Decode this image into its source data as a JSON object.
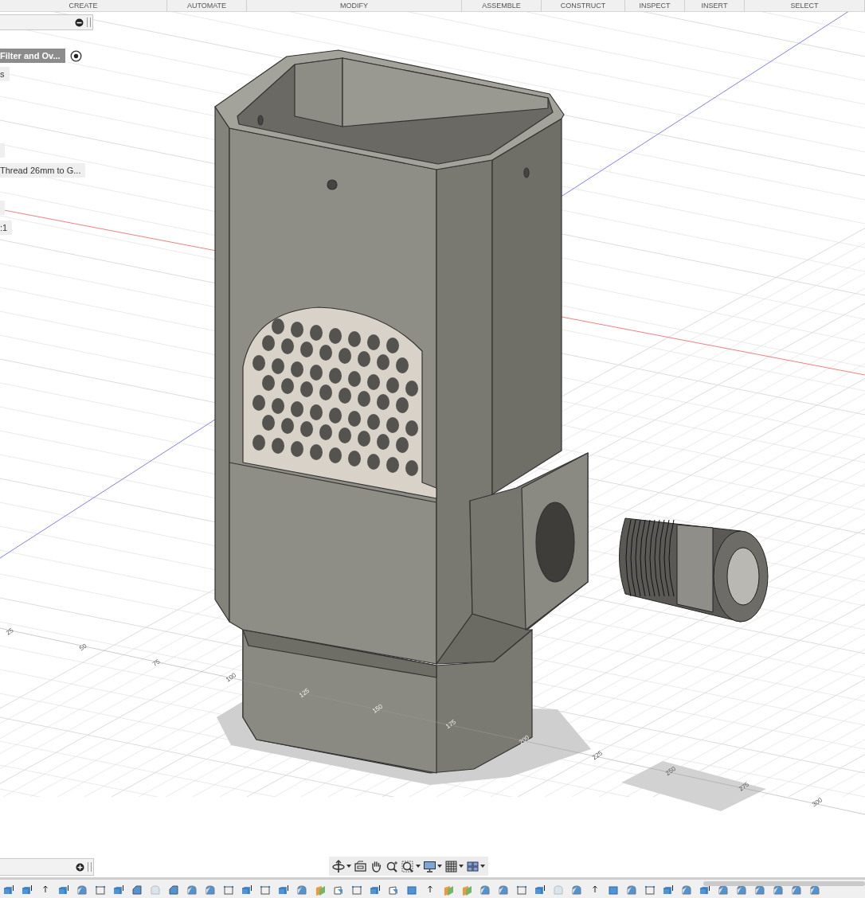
{
  "menu": [
    {
      "label": "CREATE"
    },
    {
      "label": "AUTOMATE"
    },
    {
      "label": "MODIFY"
    },
    {
      "label": "ASSEMBLE"
    },
    {
      "label": "CONSTRUCT"
    },
    {
      "label": "INSPECT"
    },
    {
      "label": "INSERT"
    },
    {
      "label": "SELECT"
    }
  ],
  "browser": {
    "items": [
      {
        "label": "Filter and Ov...",
        "selected": true
      },
      {
        "label": "s",
        "selected": false
      },
      {
        "selected": false
      },
      {
        "label": "Thread 26mm to G...",
        "selected": false
      },
      {
        "selected": false
      },
      {
        "label": ":1",
        "selected": false
      }
    ]
  },
  "ruler": [
    "25",
    "50",
    "75",
    "100",
    "125",
    "150",
    "175",
    "200",
    "225",
    "250",
    "275",
    "300"
  ],
  "timeline": [
    {
      "kind": "extrude"
    },
    {
      "kind": "extrude"
    },
    {
      "kind": "point"
    },
    {
      "kind": "extrude"
    },
    {
      "kind": "fillet"
    },
    {
      "kind": "sketch"
    },
    {
      "kind": "extrude"
    },
    {
      "kind": "chamfer"
    },
    {
      "kind": "faded"
    },
    {
      "kind": "chamfer"
    },
    {
      "kind": "fillet"
    },
    {
      "kind": "fillet"
    },
    {
      "kind": "sketch"
    },
    {
      "kind": "extrude"
    },
    {
      "kind": "sketch"
    },
    {
      "kind": "extrude"
    },
    {
      "kind": "fillet"
    },
    {
      "kind": "plane"
    },
    {
      "kind": "hole"
    },
    {
      "kind": "sketch"
    },
    {
      "kind": "extrude"
    },
    {
      "kind": "hole"
    },
    {
      "kind": "box"
    },
    {
      "kind": "point"
    },
    {
      "kind": "plane"
    },
    {
      "kind": "plane"
    },
    {
      "kind": "fillet"
    },
    {
      "kind": "fillet"
    },
    {
      "kind": "sketch"
    },
    {
      "kind": "extrude"
    },
    {
      "kind": "faded"
    },
    {
      "kind": "fillet"
    },
    {
      "kind": "point"
    },
    {
      "kind": "box"
    },
    {
      "kind": "fillet"
    },
    {
      "kind": "sketch"
    },
    {
      "kind": "extrude"
    },
    {
      "kind": "fillet"
    },
    {
      "kind": "extrude"
    },
    {
      "kind": "fillet"
    },
    {
      "kind": "fillet"
    },
    {
      "kind": "fillet"
    },
    {
      "kind": "fillet"
    },
    {
      "kind": "fillet"
    },
    {
      "kind": "fillet"
    }
  ]
}
